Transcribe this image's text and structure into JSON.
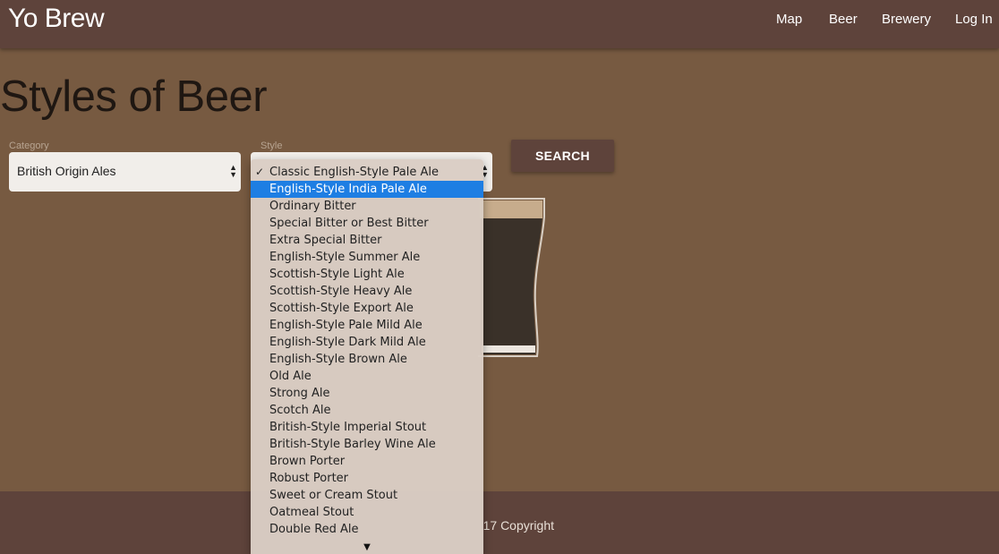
{
  "header": {
    "brand": "Yo Brew",
    "nav": [
      "Map",
      "Beer",
      "Brewery",
      "Log In"
    ]
  },
  "main": {
    "title": "Styles of Beer",
    "category": {
      "label": "Category",
      "value": "British Origin Ales"
    },
    "style": {
      "label": "Style"
    },
    "search_label": "SEARCH"
  },
  "dropdown": {
    "checkmark": "✓",
    "scroll_arrow": "▼",
    "options": [
      "Classic English-Style Pale Ale",
      "English-Style India Pale Ale",
      "Ordinary Bitter",
      "Special Bitter or Best Bitter",
      "Extra Special Bitter",
      "English-Style Summer Ale",
      "Scottish-Style Light Ale",
      "Scottish-Style Heavy Ale",
      "Scottish-Style Export Ale",
      "English-Style Pale Mild Ale",
      "English-Style Dark Mild Ale",
      "English-Style Brown Ale",
      "Old Ale",
      "Strong Ale",
      "Scotch Ale",
      "British-Style Imperial Stout",
      "British-Style Barley Wine Ale",
      "Brown Porter",
      "Robust Porter",
      "Sweet or Cream Stout",
      "Oatmeal Stout",
      "Double Red Ale"
    ]
  },
  "footer": {
    "text": "17 Copyright"
  },
  "colors": {
    "header_bg": "#5e433b",
    "page_bg": "#775a41",
    "highlight": "#1e7ee3",
    "beer": "#3a3129",
    "foam": "#c7ac8c"
  }
}
